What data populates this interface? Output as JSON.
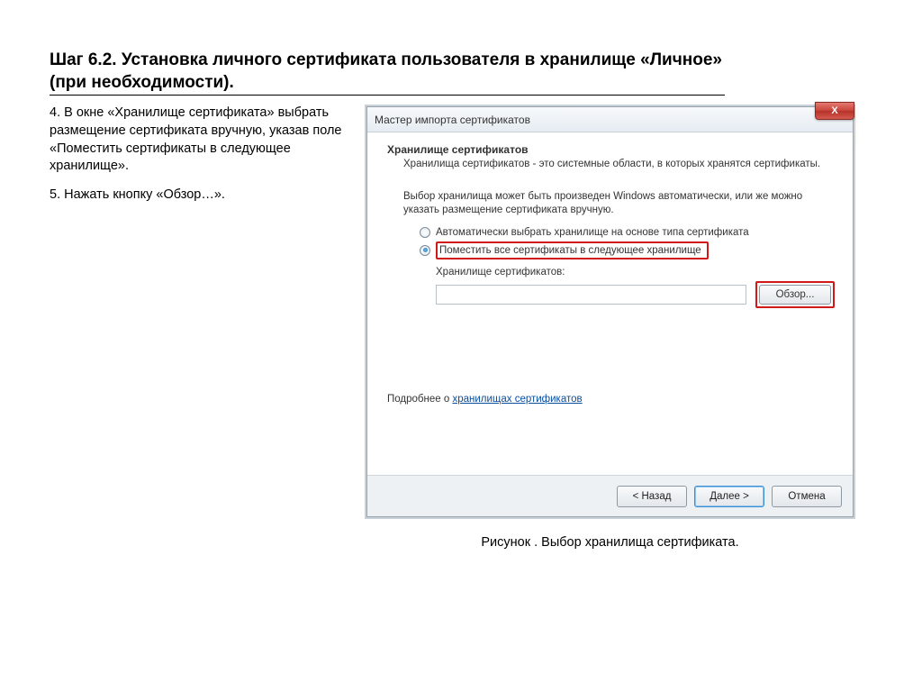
{
  "heading": "Шаг 6.2. Установка личного сертификата пользователя в хранилище «Личное» (при необходимости).",
  "instructions": {
    "p1": "4. В окне «Хранилище сертификата» выбрать размещение сертификата вручную, указав поле «Поместить сертификаты в следующее хранилище».",
    "p2": "5. Нажать кнопку «Обзор…»."
  },
  "wizard": {
    "title": "Мастер импорта сертификатов",
    "close_icon": "X",
    "section_title": "Хранилище сертификатов",
    "section_desc": "Хранилища сертификатов - это системные области, в которых хранятся сертификаты.",
    "choice_intro": "Выбор хранилища может быть произведен Windows автоматически, или же можно указать размещение сертификата вручную.",
    "radio_auto": "Автоматически выбрать хранилище на основе типа сертификата",
    "radio_manual": "Поместить все сертификаты в следующее хранилище",
    "store_label": "Хранилище сертификатов:",
    "store_value": "",
    "browse_label": "Обзор...",
    "learn_more_prefix": "Подробнее о ",
    "learn_more_link": "хранилищах сертификатов",
    "buttons": {
      "back": "< Назад",
      "next": "Далее >",
      "cancel": "Отмена"
    }
  },
  "caption": "Рисунок . Выбор хранилища сертификата."
}
